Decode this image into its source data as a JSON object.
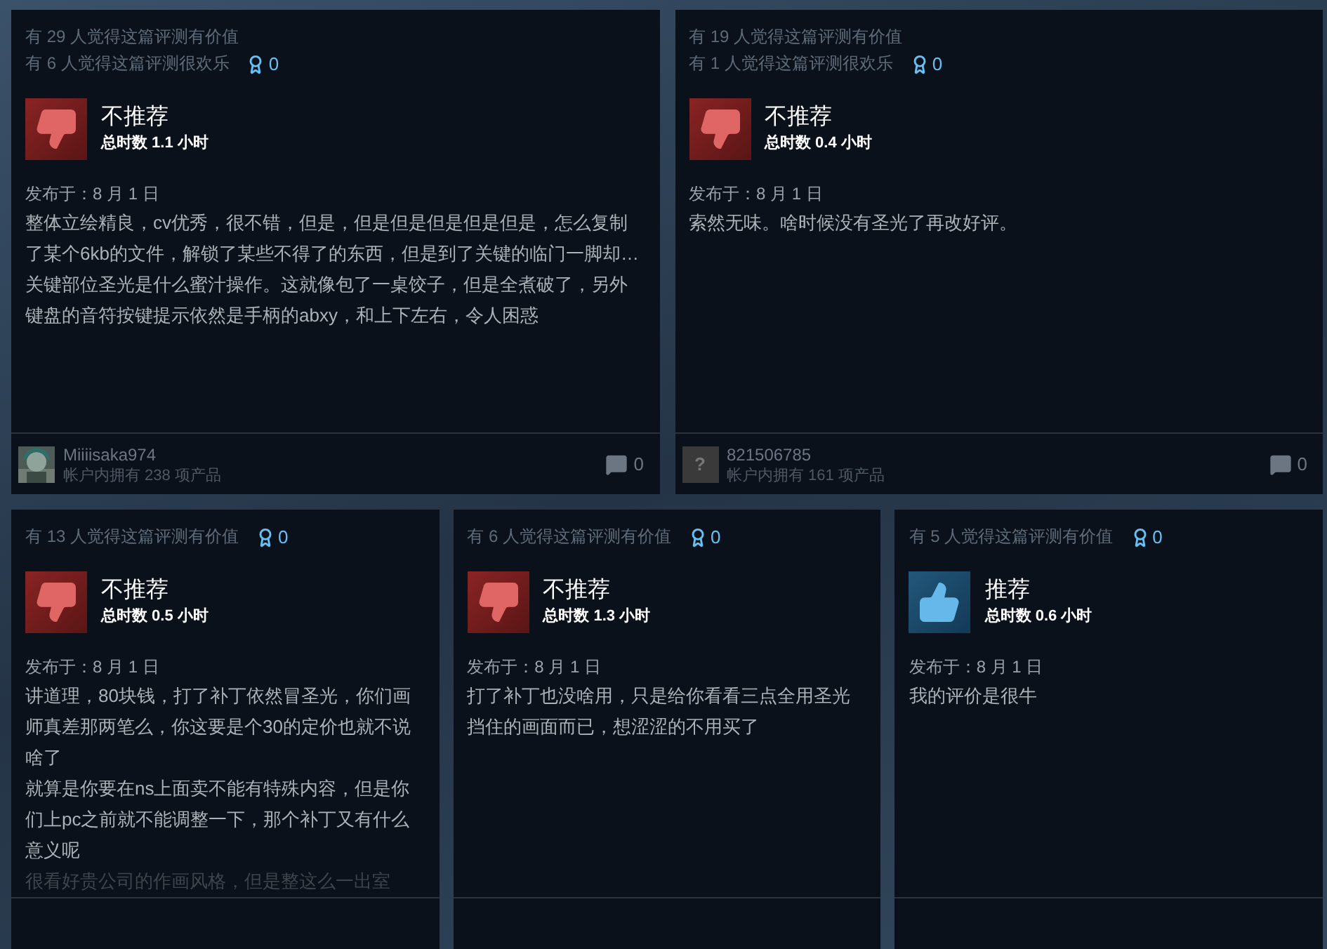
{
  "reviews": [
    {
      "helpful": "有 29 人觉得这篇评测有价值",
      "funny": "有 6 人觉得这篇评测很欢乐",
      "awards": "0",
      "kind": "not_recommended",
      "verdict": "不推荐",
      "hours": "总时数 1.1 小时",
      "date": "发布于：8 月 1 日",
      "body": [
        "整体立绘精良，cv优秀，很不错，但是，但是但是但是但是但是，怎么复制了某个6kb的文件，解锁了某些不得了的东西，但是到了关键的临门一脚却…关键部位圣光是什么蜜汁操作。这就像包了一桌饺子，但是全煮破了，另外键盘的音符按键提示依然是手柄的abxy，和上下左右，令人困惑"
      ],
      "author": {
        "name": "Miiiisaka974",
        "products": "帐户内拥有 238 项产品"
      },
      "comments": "0"
    },
    {
      "helpful": "有 19 人觉得这篇评测有价值",
      "funny": "有 1 人觉得这篇评测很欢乐",
      "awards": "0",
      "kind": "not_recommended",
      "verdict": "不推荐",
      "hours": "总时数 0.4 小时",
      "date": "发布于：8 月 1 日",
      "body": [
        "索然无味。啥时候没有圣光了再改好评。"
      ],
      "author": {
        "name": "821506785",
        "products": "帐户内拥有 161 项产品",
        "avatar": {
          "kind": "unknown",
          "glyph": "?"
        }
      },
      "comments": "0"
    },
    {
      "helpful": "有 13 人觉得这篇评测有价值",
      "awards": "0",
      "kind": "not_recommended",
      "verdict": "不推荐",
      "hours": "总时数 0.5 小时",
      "date": "发布于：8 月 1 日",
      "body": [
        "讲道理，80块钱，打了补丁依然冒圣光，你们画师真差那两笔么，你这要是个30的定价也就不说啥了",
        "就算是你要在ns上面卖不能有特殊内容，但是你们上pc之前就不能调整一下，那个补丁又有什么意义呢"
      ],
      "faded_text": "很看好贵公司的作画风格，但是整这么一出室"
    },
    {
      "helpful": "有 6 人觉得这篇评测有价值",
      "awards": "0",
      "kind": "not_recommended",
      "verdict": "不推荐",
      "hours": "总时数 1.3 小时",
      "date": "发布于：8 月 1 日",
      "body": [
        "打了补丁也没啥用，只是给你看看三点全用圣光挡住的画面而已，想涩涩的不用买了"
      ]
    },
    {
      "helpful": "有 5 人觉得这篇评测有价值",
      "awards": "0",
      "kind": "recommended",
      "verdict": "推荐",
      "hours": "总时数 0.6 小时",
      "date": "发布于：8 月 1 日",
      "body": [
        "我的评价是很牛"
      ]
    }
  ]
}
